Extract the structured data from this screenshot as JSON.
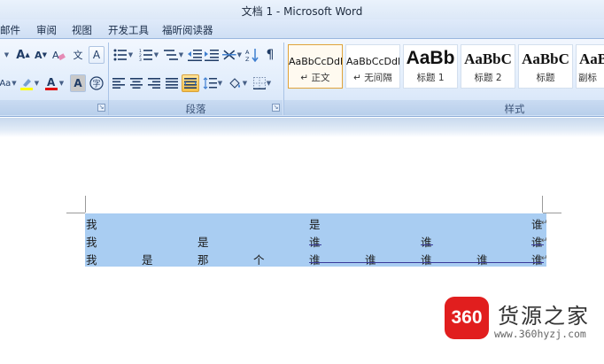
{
  "window": {
    "title": "文档 1 - Microsoft Word"
  },
  "menu_tabs": [
    "邮件",
    "审阅",
    "视图",
    "开发工具",
    "福昕阅读器"
  ],
  "ribbon": {
    "groups": [
      {
        "label": "段落"
      },
      {
        "label": "样式"
      }
    ],
    "font_buttons": {
      "grow": "A",
      "shrink": "A",
      "clear": "A",
      "phonetic": "文",
      "border_char": "A",
      "highlight": "ab",
      "color": "A",
      "shade_char": "A",
      "enclose": "字"
    },
    "styles": [
      {
        "sample": "AaBbCcDdI",
        "name": "↵ 正文",
        "selected": true
      },
      {
        "sample": "AaBbCcDdI",
        "name": "↵ 无间隔",
        "selected": false
      },
      {
        "sample": "AaBb",
        "name": "标题 1",
        "selected": false
      },
      {
        "sample": "AaBbC",
        "name": "标题 2",
        "selected": false
      },
      {
        "sample": "AaBbC",
        "name": "标题",
        "selected": false
      },
      {
        "sample": "AaB",
        "name": "副标",
        "selected": false
      }
    ]
  },
  "document": {
    "rows": [
      [
        "我",
        "",
        "",
        "",
        "是",
        "",
        "",
        "",
        "谁"
      ],
      [
        "我",
        "",
        "是",
        "",
        "谁",
        "",
        "谁",
        "",
        "谁"
      ],
      [
        "我",
        "是",
        "那",
        "个",
        "谁",
        "谁",
        "谁",
        "谁",
        "谁"
      ]
    ],
    "paragraph_mark": "↵"
  },
  "watermark": {
    "logo_text": "360",
    "brand": "货源之家",
    "url": "www.360hyzj.com"
  },
  "colors": {
    "selection": "#a9cdf2",
    "ribbon_top": "#f2f7fe",
    "ribbon_bottom": "#d3e2f6",
    "style_selected_border": "#e0a33a",
    "logo_red": "#e11e1e"
  }
}
